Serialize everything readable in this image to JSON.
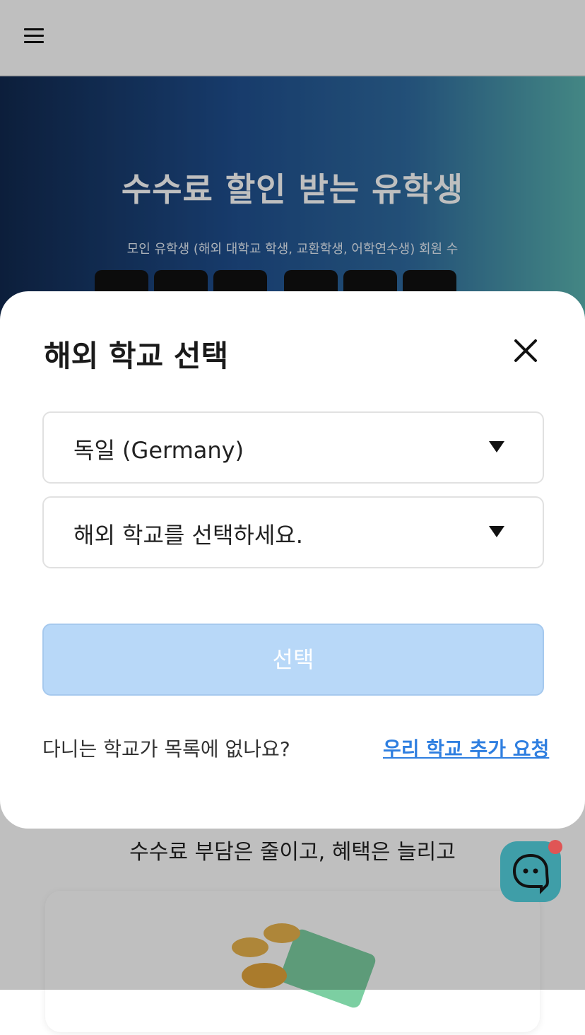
{
  "hero": {
    "title": "수수료 할인 받는 유학생",
    "subtitle": "모인 유학생 (해외 대학교 학생, 교환학생, 어학연수생) 회원 수"
  },
  "modal": {
    "title": "해외 학교 선택",
    "country_select_value": "독일 (Germany)",
    "school_select_placeholder": "해외 학교를 선택하세요.",
    "submit_label": "선택",
    "footer_question": "다니는 학교가 목록에 없나요?",
    "footer_link": "우리 학교 추가 요청"
  },
  "section": {
    "tagline": "수수료 부담은 줄이고, 혜택은 늘리고"
  },
  "icons": {
    "menu": "hamburger-menu-icon",
    "close": "close-icon",
    "dropdown": "chevron-down-icon",
    "chat": "chat-bubble-icon"
  },
  "colors": {
    "primary_disabled": "#b8d8f8",
    "link": "#2f7fe0",
    "chat_button": "#3f9ea8",
    "notification_dot": "#e05555"
  }
}
